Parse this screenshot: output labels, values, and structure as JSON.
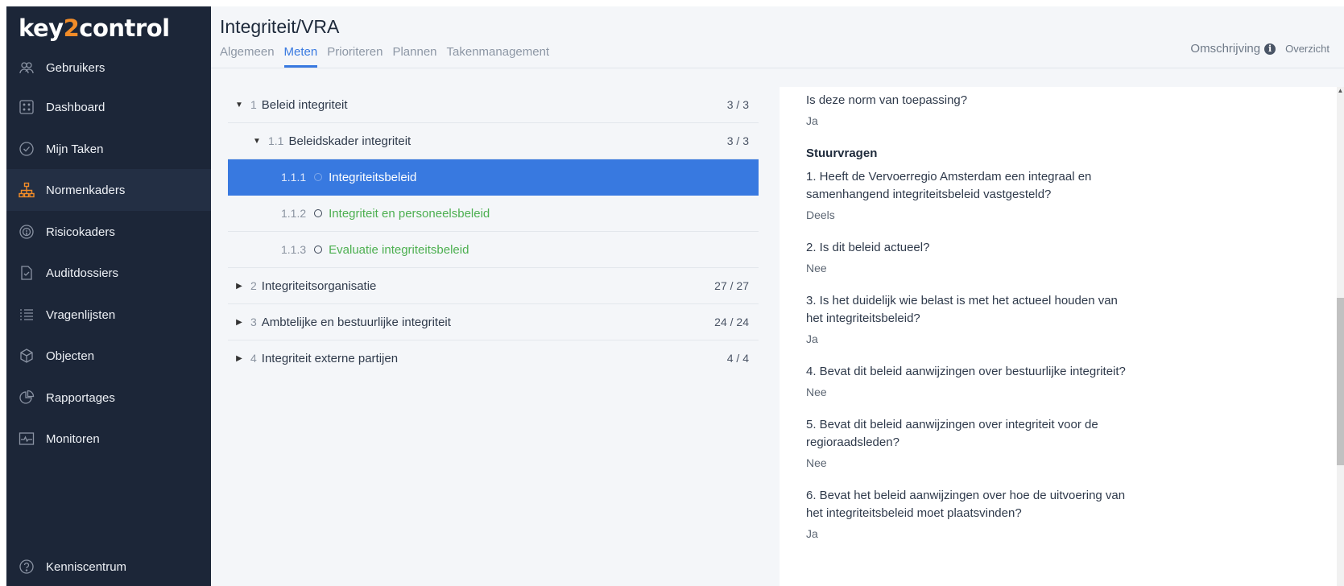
{
  "sidebar": {
    "logo": {
      "part1": "key",
      "part2": "2",
      "part3": "control"
    },
    "items": [
      {
        "label": "Gebruikers",
        "icon": "users-icon"
      },
      {
        "label": "Dashboard",
        "icon": "dashboard-icon"
      },
      {
        "label": "Mijn Taken",
        "icon": "check-circle-icon"
      },
      {
        "label": "Normenkaders",
        "icon": "hierarchy-icon",
        "active": true
      },
      {
        "label": "Risicokaders",
        "icon": "risk-icon"
      },
      {
        "label": "Auditdossiers",
        "icon": "audit-file-icon"
      },
      {
        "label": "Vragenlijsten",
        "icon": "list-icon"
      },
      {
        "label": "Objecten",
        "icon": "cube-icon"
      },
      {
        "label": "Rapportages",
        "icon": "pie-chart-icon"
      },
      {
        "label": "Monitoren",
        "icon": "monitor-icon"
      }
    ],
    "footer": {
      "label": "Kenniscentrum",
      "icon": "help-circle-icon"
    },
    "accent": "#f28c28"
  },
  "header": {
    "title": "Integriteit/VRA",
    "tabs": [
      {
        "label": "Algemeen"
      },
      {
        "label": "Meten",
        "active": true
      },
      {
        "label": "Prioriteren"
      },
      {
        "label": "Plannen"
      },
      {
        "label": "Takenmanagement"
      }
    ],
    "omschrijving": "Omschrijving",
    "overzicht": "Overzicht"
  },
  "tree": {
    "rows": [
      {
        "num": "1",
        "label": "Beleid integriteit",
        "count": "3 / 3"
      },
      {
        "num": "1.1",
        "label": "Beleidskader integriteit",
        "count": "3 / 3"
      },
      {
        "num": "1.1.1",
        "label": "Integriteitsbeleid"
      },
      {
        "num": "1.1.2",
        "label": "Integriteit en personeelsbeleid"
      },
      {
        "num": "1.1.3",
        "label": "Evaluatie integriteitsbeleid"
      },
      {
        "num": "2",
        "label": "Integriteitsorganisatie",
        "count": "27 / 27"
      },
      {
        "num": "3",
        "label": "Ambtelijke en bestuurlijke integriteit",
        "count": "24 / 24"
      },
      {
        "num": "4",
        "label": "Integriteit externe partijen",
        "count": "4 / 4"
      }
    ],
    "selected_color": "#3879e0",
    "green_color": "#4caf50"
  },
  "panel": {
    "norm_question": "Is deze norm van toepassing?",
    "norm_answer": "Ja",
    "section_title": "Stuurvragen",
    "questions": [
      {
        "text": "1. Heeft de Vervoerregio Amsterdam een integraal en samenhangend integriteitsbeleid vastgesteld?",
        "answer": "Deels"
      },
      {
        "text": "2. Is dit beleid actueel?",
        "answer": "Nee"
      },
      {
        "text": "3. Is het duidelijk wie belast is met het actueel houden van het integriteitsbeleid?",
        "answer": "Ja"
      },
      {
        "text": "4. Bevat dit beleid aanwijzingen over bestuurlijke integriteit?",
        "answer": "Nee"
      },
      {
        "text": "5. Bevat dit beleid aanwijzingen over integriteit voor de regioraadsleden?",
        "answer": "Nee"
      },
      {
        "text": "6. Bevat het beleid aanwijzingen over hoe de uitvoering van het integriteitsbeleid moet plaatsvinden?",
        "answer": "Ja"
      }
    ]
  }
}
